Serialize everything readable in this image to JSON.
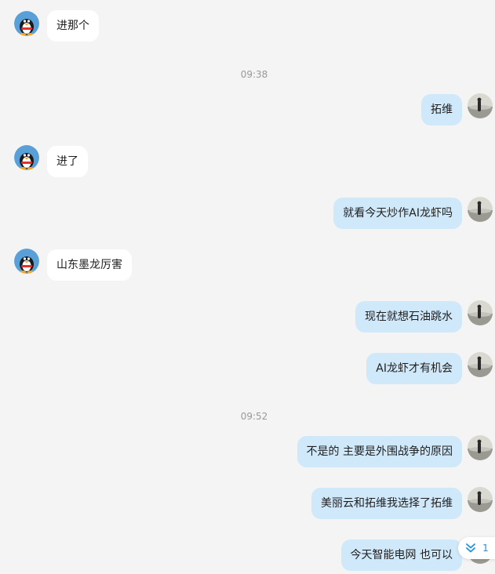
{
  "messages": [
    {
      "side": "in",
      "text": "进那个"
    },
    {
      "side": "out",
      "text": "拓维"
    },
    {
      "side": "in",
      "text": "进了"
    },
    {
      "side": "out",
      "text": "就看今天炒作AI龙虾吗"
    },
    {
      "side": "in",
      "text": "山东墨龙厉害"
    },
    {
      "side": "out",
      "text": "现在就想石油跳水"
    },
    {
      "side": "out",
      "text": "AI龙虾才有机会"
    },
    {
      "side": "out",
      "text": "不是的 主要是外围战争的原因"
    },
    {
      "side": "out",
      "text": "美丽云和拓维我选择了拓维"
    },
    {
      "side": "out",
      "text": "今天智能电网 也可以"
    }
  ],
  "timestamps": [
    "09:38",
    "09:52"
  ],
  "unread": {
    "count": "1",
    "icon": "double-chevron-down-icon"
  },
  "avatars": {
    "left": "qq-penguin-avatar",
    "right": "person-silhouette-avatar"
  },
  "colors": {
    "background": "#f4f4f4",
    "incoming_bubble": "#ffffff",
    "outgoing_bubble": "#cfe9fb",
    "accent": "#1f8fe0",
    "timestamp": "#999999"
  }
}
